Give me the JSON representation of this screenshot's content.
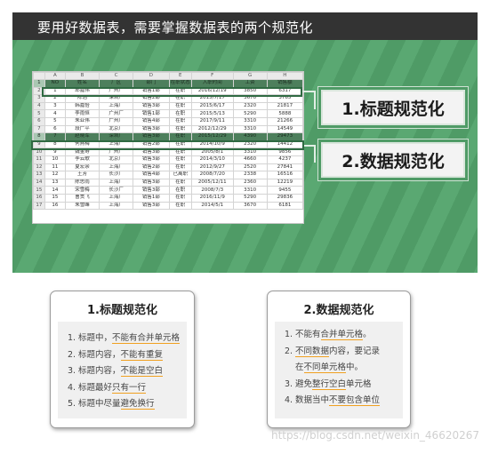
{
  "slide": {
    "title": "要用好数据表，需要掌握数据表的两个规范化",
    "callouts": [
      "1.标题规范化",
      "2.数据规范化"
    ],
    "sheet": {
      "columns": [
        "",
        "A",
        "B",
        "C",
        "D",
        "E",
        "F",
        "G",
        "H"
      ],
      "rows": [
        [
          "1",
          "NO",
          "姓名",
          "厂区",
          "部门",
          "在职状态",
          "入职时间",
          "工资",
          "销售额"
        ],
        [
          "2",
          "1",
          "邱嘉伟",
          "广州厂",
          "销售1部",
          "在职",
          "2016/12/19",
          "3850",
          "6317"
        ],
        [
          "3",
          "2",
          "陈浩",
          "深圳厂",
          "销售2部",
          "在职",
          "2015/7/17",
          "3670",
          "3765"
        ],
        [
          "4",
          "3",
          "韩嘉怡",
          "上海厂",
          "销售3部",
          "在职",
          "2015/6/17",
          "2320",
          "21817"
        ],
        [
          "5",
          "4",
          "李雨恒",
          "广州厂",
          "销售1部",
          "在职",
          "2015/5/13",
          "5290",
          "5888"
        ],
        [
          "6",
          "5",
          "朱亚伟",
          "广州厂",
          "销售4部",
          "在职",
          "2017/9/11",
          "3310",
          "21266"
        ],
        [
          "7",
          "6",
          "段广平",
          "北京厂",
          "销售3部",
          "在职",
          "2012/12/29",
          "3310",
          "14549"
        ],
        [
          "8",
          "7",
          "赵晓军",
          "深圳厂",
          "销售3部",
          "在职",
          "2015/12/29",
          "4390",
          "29473"
        ],
        [
          "9",
          "8",
          "何燕梅",
          "上海厂",
          "销售2部",
          "在职",
          "2014/10/9",
          "2320",
          "14412"
        ],
        [
          "10",
          "9",
          "魏金寿",
          "广州厂",
          "销售3部",
          "在职",
          "2005/8/1",
          "3310",
          "9856"
        ],
        [
          "11",
          "10",
          "李云歌",
          "北京厂",
          "销售3部",
          "在职",
          "2014/3/10",
          "4660",
          "4237"
        ],
        [
          "12",
          "11",
          "夏宏余",
          "上海厂",
          "销售2部",
          "在职",
          "2012/9/27",
          "2520",
          "27841"
        ],
        [
          "13",
          "12",
          "王芳",
          "长沙厂",
          "销售4部",
          "已离职",
          "2008/7/20",
          "2338",
          "16516"
        ],
        [
          "14",
          "13",
          "陈思雨",
          "上海厂",
          "销售3部",
          "在职",
          "2005/12/11",
          "2360",
          "12219"
        ],
        [
          "15",
          "14",
          "宋雪梅",
          "长沙厂",
          "销售3部",
          "在职",
          "2008/7/3",
          "3310",
          "9455"
        ],
        [
          "16",
          "15",
          "曹贯飞",
          "上海厂",
          "销售1部",
          "在职",
          "2016/11/9",
          "5290",
          "29836"
        ],
        [
          "17",
          "16",
          "朱雪峰",
          "上海厂",
          "销售3部",
          "在职",
          "2014/5/1",
          "3670",
          "6181"
        ]
      ]
    }
  },
  "cards": [
    {
      "title": "1.标题规范化",
      "items": [
        {
          "num": "1.",
          "parts": [
            [
              "标题中，",
              false
            ],
            [
              "不能有合并单元格",
              true
            ]
          ]
        },
        {
          "num": "2.",
          "parts": [
            [
              "标题内容，",
              false
            ],
            [
              "不能有重复",
              true
            ]
          ]
        },
        {
          "num": "3.",
          "parts": [
            [
              "标题内容，",
              false
            ],
            [
              "不能是空白",
              true
            ]
          ]
        },
        {
          "num": "4.",
          "parts": [
            [
              "标题最好",
              false
            ],
            [
              "只有一行",
              true
            ]
          ]
        },
        {
          "num": "5.",
          "parts": [
            [
              "标题中尽量",
              false
            ],
            [
              "避免换行",
              true
            ]
          ]
        }
      ]
    },
    {
      "title": "2.数据规范化",
      "items": [
        {
          "num": "1.",
          "parts": [
            [
              "不能有",
              false
            ],
            [
              "合并单元格",
              true
            ],
            [
              "。",
              false
            ]
          ]
        },
        {
          "num": "2.",
          "parts": [
            [
              "不同数据",
              true
            ],
            [
              "内容，要记录",
              false
            ]
          ]
        },
        {
          "num": "",
          "parts": [
            [
              "在",
              false
            ],
            [
              "不同单元格",
              true
            ],
            [
              "中。",
              false
            ]
          ]
        },
        {
          "num": "3.",
          "parts": [
            [
              "避免",
              false
            ],
            [
              "整行空白",
              true
            ],
            [
              "单元格",
              false
            ]
          ]
        },
        {
          "num": "4.",
          "parts": [
            [
              "数据当中",
              false
            ],
            [
              "不要包含单位",
              true
            ]
          ]
        }
      ]
    }
  ],
  "watermark": "https://blog.csdn.net/weixin_46620267"
}
